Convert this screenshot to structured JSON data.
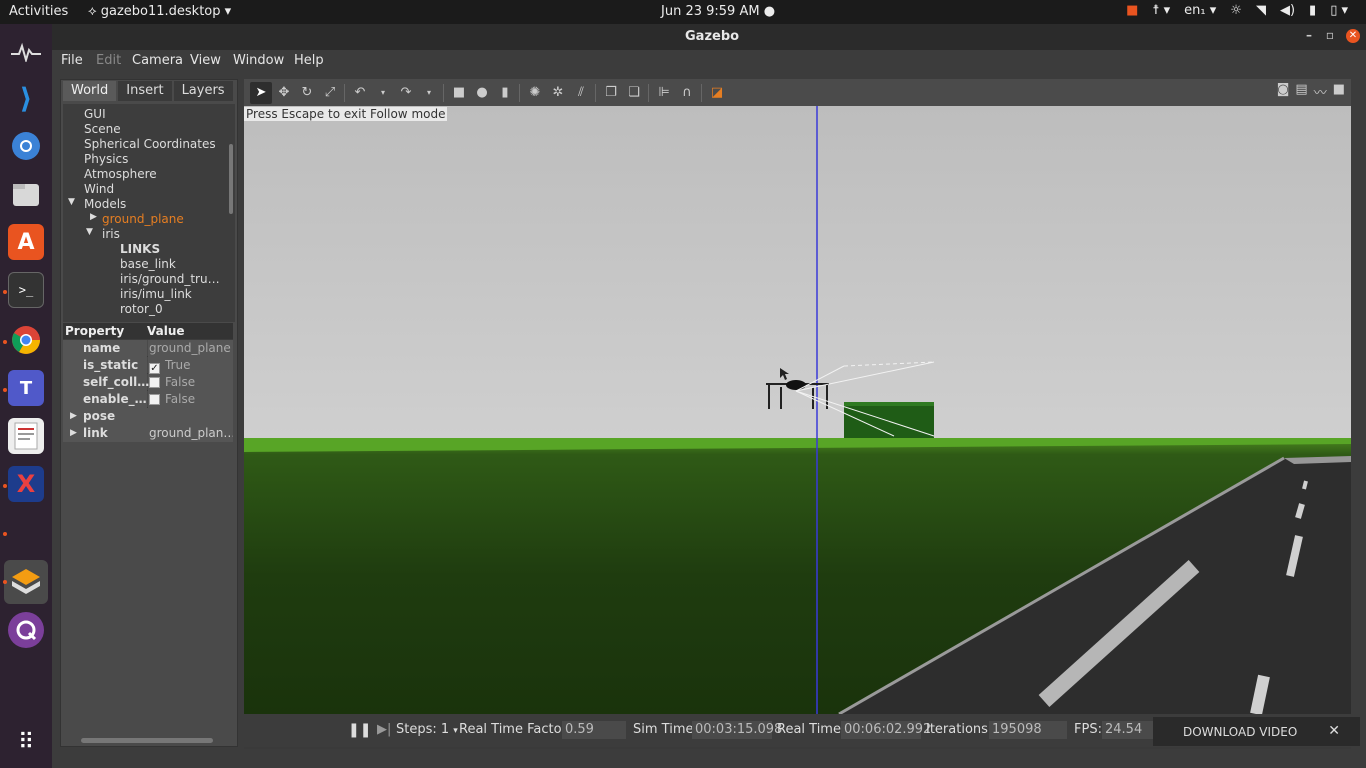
{
  "topbar": {
    "activities": "Activities",
    "app": "gazebo11.desktop",
    "clock": "Jun 23  9:59 AM",
    "lang": "en₁"
  },
  "window": {
    "title": "Gazebo",
    "menu": [
      "File",
      "Edit",
      "Camera",
      "View",
      "Window",
      "Help"
    ]
  },
  "left_panel": {
    "tabs": [
      "World",
      "Insert",
      "Layers"
    ],
    "tree": {
      "gui": "GUI",
      "scene": "Scene",
      "spherical": "Spherical Coordinates",
      "physics": "Physics",
      "atmosphere": "Atmosphere",
      "wind": "Wind",
      "models": "Models",
      "ground_plane": "ground_plane",
      "iris": "iris",
      "links": "LINKS",
      "base_link": "base_link",
      "ground_truth": "iris/ground_tru…",
      "imu_link": "iris/imu_link",
      "rotor_0": "rotor_0"
    },
    "props": {
      "header_property": "Property",
      "header_value": "Value",
      "name_key": "name",
      "name_val": "ground_plane",
      "static_key": "is_static",
      "static_val": "True",
      "selfcoll_key": "self_coll…",
      "selfcoll_val": "False",
      "enable_key": "enable_…",
      "enable_val": "False",
      "pose_key": "pose",
      "link_key": "link",
      "link_val": "ground_plan…"
    }
  },
  "viewport": {
    "hint": "Press Escape to exit Follow mode"
  },
  "status": {
    "steps_label": "Steps: 1",
    "rtf_label": "Real Time Factor:",
    "rtf_val": "0.59",
    "sim_label": "Sim Time:",
    "sim_val": "00:03:15.098",
    "real_label": "Real Time:",
    "real_val": "00:06:02.992",
    "iter_label": "Iterations:",
    "iter_val": "195098",
    "fps_label": "FPS:",
    "fps_val": "24.54"
  },
  "download": {
    "label": "DOWNLOAD VIDEO"
  }
}
